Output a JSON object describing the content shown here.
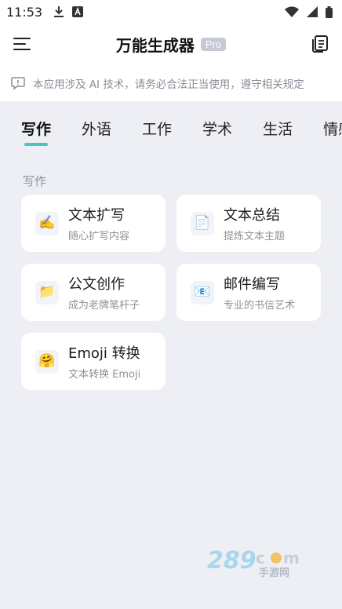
{
  "status_bar": {
    "time": "11:53",
    "icons": [
      "download-icon",
      "font-app-icon",
      "wifi-icon",
      "signal-icon",
      "battery-icon"
    ]
  },
  "header": {
    "title": "万能生成器",
    "badge": "Pro",
    "menu_icon": "hamburger-menu-icon",
    "history_icon": "document-list-icon"
  },
  "notice": {
    "icon": "info-message-icon",
    "text": "本应用涉及 AI 技术，请务必合法正当使用，遵守相关规定"
  },
  "tabs": [
    {
      "label": "写作",
      "active": true
    },
    {
      "label": "外语",
      "active": false
    },
    {
      "label": "工作",
      "active": false
    },
    {
      "label": "学术",
      "active": false
    },
    {
      "label": "生活",
      "active": false
    },
    {
      "label": "情感",
      "active": false
    }
  ],
  "section": {
    "title": "写作",
    "cards": [
      {
        "title": "文本扩写",
        "subtitle": "随心扩写内容",
        "icon": "writing-hand-icon",
        "glyph": "✍️"
      },
      {
        "title": "文本总结",
        "subtitle": "提炼文本主题",
        "icon": "document-summary-icon",
        "glyph": "📄"
      },
      {
        "title": "公文创作",
        "subtitle": "成为老牌笔杆子",
        "icon": "folder-document-icon",
        "glyph": "📁"
      },
      {
        "title": "邮件编写",
        "subtitle": "专业的书信艺术",
        "icon": "envelope-icon",
        "glyph": "📧"
      },
      {
        "title": "Emoji 转换",
        "subtitle": "文本转换 Emoji",
        "icon": "emoji-hug-icon",
        "glyph": "🤗"
      }
    ]
  },
  "colors": {
    "accent": "#4cc3c3",
    "background": "#eeeff4",
    "card": "#ffffff",
    "muted_text": "#8e919a"
  }
}
